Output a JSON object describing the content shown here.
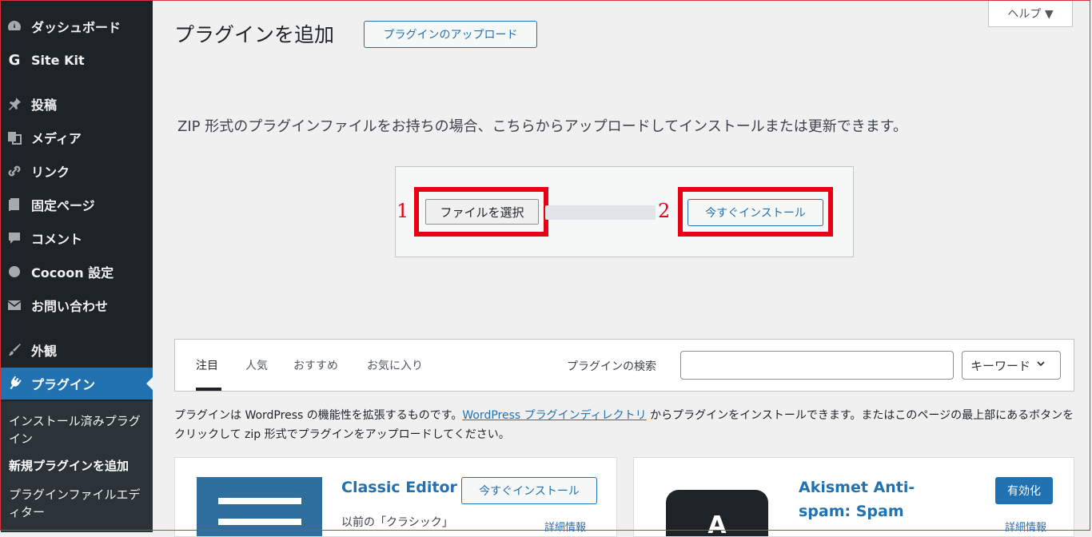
{
  "sidebar": {
    "items": [
      {
        "label": "ダッシュボード",
        "icon": "dashboard-icon"
      },
      {
        "label": "Site Kit",
        "icon": "sitekit-g-icon"
      },
      {
        "label": "投稿",
        "icon": "pin-icon"
      },
      {
        "label": "メディア",
        "icon": "media-icon"
      },
      {
        "label": "リンク",
        "icon": "link-icon"
      },
      {
        "label": "固定ページ",
        "icon": "page-icon"
      },
      {
        "label": "コメント",
        "icon": "comment-icon"
      },
      {
        "label": "Cocoon 設定",
        "icon": "circle-icon"
      },
      {
        "label": "お問い合わせ",
        "icon": "mail-icon"
      },
      {
        "label": "外観",
        "icon": "brush-icon"
      },
      {
        "label": "プラグイン",
        "icon": "plugin-icon"
      }
    ],
    "submenu": {
      "installed": "インストール済みプラグイン",
      "add_new": "新規プラグインを追加",
      "editor": "プラグインファイルエディター"
    }
  },
  "header": {
    "title": "プラグインを追加",
    "upload_button": "プラグインのアップロード",
    "help_tab": "ヘルプ ▼"
  },
  "upload": {
    "description": "ZIP 形式のプラグインファイルをお持ちの場合、こちらからアップロードしてインストールまたは更新できます。",
    "choose_file": "ファイルを選択",
    "install_now": "今すぐインストール",
    "callout_1": "1",
    "callout_2": "2",
    "highlight_color": "#e60012"
  },
  "filter": {
    "tabs": [
      "注目",
      "人気",
      "おすすめ",
      "お気に入り"
    ],
    "search_label": "プラグインの検索",
    "search_value": "",
    "search_type": "キーワード"
  },
  "intro": {
    "before_link": "プラグインは WordPress の機能性を拡張するものです。",
    "link_text": "WordPress プラグインディレクトリ",
    "after_link": " からプラグインをインストールできます。またはこのページの最上部にあるボタンをクリックして zip 形式でプラグインをアップロードしてください。"
  },
  "cards": [
    {
      "name": "Classic Editor",
      "button": "今すぐインストール",
      "desc": "以前の「クラシック」",
      "details": "詳細情報"
    },
    {
      "name": "Akismet Anti-spam: Spam",
      "name_line1": "Akismet Anti-",
      "name_line2": "spam: Spam",
      "button": "有効化",
      "details": "詳細情報"
    }
  ],
  "colors": {
    "sidebar_bg": "#1d2327",
    "accent": "#2271b1",
    "highlight": "#e60012"
  }
}
